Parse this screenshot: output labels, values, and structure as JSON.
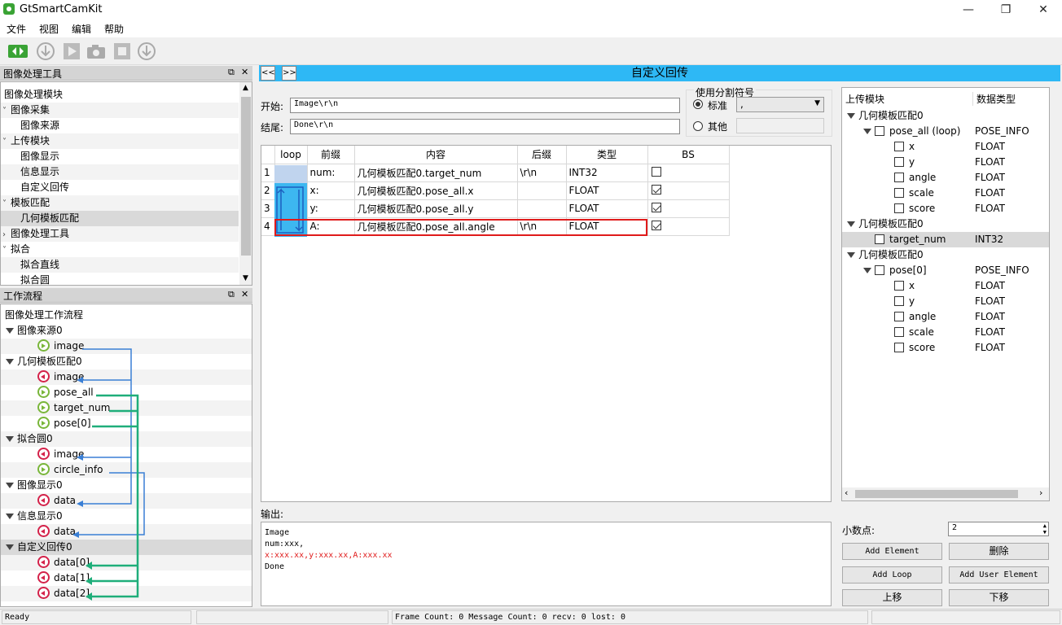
{
  "app": {
    "title": "GtSmartCamKit"
  },
  "menu": [
    "文件",
    "视图",
    "编辑",
    "帮助"
  ],
  "tool_panel": {
    "title": "图像处理工具",
    "items": [
      {
        "label": "图像处理模块",
        "level": 0,
        "kind": "plain"
      },
      {
        "label": "图像采集",
        "level": 0,
        "kind": "open"
      },
      {
        "label": "图像来源",
        "level": 1,
        "kind": "leaf"
      },
      {
        "label": "上传模块",
        "level": 0,
        "kind": "open"
      },
      {
        "label": "图像显示",
        "level": 1,
        "kind": "leaf"
      },
      {
        "label": "信息显示",
        "level": 1,
        "kind": "leaf"
      },
      {
        "label": "自定义回传",
        "level": 1,
        "kind": "leaf"
      },
      {
        "label": "模板匹配",
        "level": 0,
        "kind": "open"
      },
      {
        "label": "几何模板匹配",
        "level": 1,
        "kind": "leaf",
        "selected": true
      },
      {
        "label": "图像处理工具",
        "level": 0,
        "kind": "closed"
      },
      {
        "label": "拟合",
        "level": 0,
        "kind": "open"
      },
      {
        "label": "拟合直线",
        "level": 1,
        "kind": "leaf"
      },
      {
        "label": "拟合圆",
        "level": 1,
        "kind": "leaf"
      }
    ]
  },
  "flow_panel": {
    "title": "工作流程",
    "root": "图像处理工作流程",
    "nodes": [
      {
        "label": "图像来源0",
        "kind": "group"
      },
      {
        "label": "image",
        "kind": "out"
      },
      {
        "label": "几何模板匹配0",
        "kind": "group"
      },
      {
        "label": "image",
        "kind": "in"
      },
      {
        "label": "pose_all",
        "kind": "out"
      },
      {
        "label": "target_num",
        "kind": "out"
      },
      {
        "label": "pose[0]",
        "kind": "out"
      },
      {
        "label": "拟合圆0",
        "kind": "group"
      },
      {
        "label": "image",
        "kind": "in"
      },
      {
        "label": "circle_info",
        "kind": "out"
      },
      {
        "label": "图像显示0",
        "kind": "group"
      },
      {
        "label": "data",
        "kind": "in"
      },
      {
        "label": "信息显示0",
        "kind": "group"
      },
      {
        "label": "data",
        "kind": "in"
      },
      {
        "label": "自定义回传0",
        "kind": "group",
        "selected": true
      },
      {
        "label": "data[0]",
        "kind": "in"
      },
      {
        "label": "data[1]",
        "kind": "in"
      },
      {
        "label": "data[2]",
        "kind": "in"
      }
    ]
  },
  "main": {
    "title": "自定义回传",
    "prev_label": "<<",
    "next_label": ">>",
    "start_label": "开始:",
    "start_value": "Image\\r\\n",
    "end_label": "结尾:",
    "end_value": "Done\\r\\n",
    "separator_group": "使用分割符号",
    "radio_standard": "标准",
    "radio_other": "其他",
    "separator_value": ",",
    "table": {
      "headers": [
        "loop",
        "前缀",
        "内容",
        "后缀",
        "类型",
        "BS"
      ],
      "rows": [
        {
          "n": "1",
          "prefix": "num:",
          "content": "几何模板匹配0.target_num",
          "suffix": "\\r\\n",
          "type": "INT32",
          "bs": false
        },
        {
          "n": "2",
          "prefix": "x:",
          "content": "几何模板匹配0.pose_all.x",
          "suffix": "",
          "type": "FLOAT",
          "bs": true
        },
        {
          "n": "3",
          "prefix": "y:",
          "content": "几何模板匹配0.pose_all.y",
          "suffix": "",
          "type": "FLOAT",
          "bs": true
        },
        {
          "n": "4",
          "prefix": "A:",
          "content": "几何模板匹配0.pose_all.angle",
          "suffix": "\\r\\n",
          "type": "FLOAT",
          "bs": true
        }
      ]
    },
    "output_label": "输出:",
    "output_lines": [
      "Image",
      "num:xxx,",
      "x:xxx.xx,y:xxx.xx,A:xxx.xx",
      "Done"
    ]
  },
  "upload_tree": {
    "col1": "上传模块",
    "col2": "数据类型",
    "rows": [
      {
        "label": "几何模板匹配0",
        "type": "",
        "level": 0,
        "expand": true,
        "cb": false
      },
      {
        "label": "pose_all (loop)",
        "type": "POSE_INFO",
        "level": 1,
        "expand": true,
        "cb": true
      },
      {
        "label": "x",
        "type": "FLOAT",
        "level": 2,
        "expand": false,
        "cb": true
      },
      {
        "label": "y",
        "type": "FLOAT",
        "level": 2,
        "expand": false,
        "cb": true
      },
      {
        "label": "angle",
        "type": "FLOAT",
        "level": 2,
        "expand": false,
        "cb": true
      },
      {
        "label": "scale",
        "type": "FLOAT",
        "level": 2,
        "expand": false,
        "cb": true
      },
      {
        "label": "score",
        "type": "FLOAT",
        "level": 2,
        "expand": false,
        "cb": true
      },
      {
        "label": "几何模板匹配0",
        "type": "",
        "level": 0,
        "expand": true,
        "cb": false
      },
      {
        "label": "target_num",
        "type": "INT32",
        "level": 1,
        "expand": false,
        "cb": true,
        "selected": true
      },
      {
        "label": "几何模板匹配0",
        "type": "",
        "level": 0,
        "expand": true,
        "cb": false
      },
      {
        "label": "pose[0]",
        "type": "POSE_INFO",
        "level": 1,
        "expand": true,
        "cb": true
      },
      {
        "label": "x",
        "type": "FLOAT",
        "level": 2,
        "expand": false,
        "cb": true
      },
      {
        "label": "y",
        "type": "FLOAT",
        "level": 2,
        "expand": false,
        "cb": true
      },
      {
        "label": "angle",
        "type": "FLOAT",
        "level": 2,
        "expand": false,
        "cb": true
      },
      {
        "label": "scale",
        "type": "FLOAT",
        "level": 2,
        "expand": false,
        "cb": true
      },
      {
        "label": "score",
        "type": "FLOAT",
        "level": 2,
        "expand": false,
        "cb": true
      }
    ]
  },
  "controls": {
    "decimal_label": "小数点:",
    "decimal_value": "2",
    "add_element": "Add Element",
    "delete": "删除",
    "add_loop": "Add Loop",
    "add_user_element": "Add User Element",
    "move_up": "上移",
    "move_down": "下移"
  },
  "status": {
    "ready": "Ready",
    "frame_info": "Frame Count: 0 Message Count: 0  recv: 0  lost: 0"
  },
  "colors": {
    "accent": "#2eb8f5",
    "link_blue": "#3a7fd5",
    "link_green": "#1fae7a",
    "highlight_red": "#e01b1b"
  }
}
